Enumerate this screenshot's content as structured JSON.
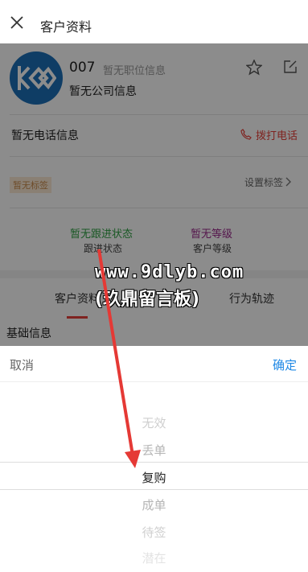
{
  "header": {
    "title": "客户资料"
  },
  "profile": {
    "name": "007",
    "job": "暂无职位信息",
    "company": "暂无公司信息",
    "phone": "暂无电话信息",
    "call_label": "拨打电话",
    "tag": "暂无标签",
    "set_tags": "设置标签",
    "follow_status": "暂无跟进状态",
    "follow_label": "跟进状态",
    "level_status": "暂无等级",
    "level_label": "客户等级"
  },
  "tabs": [
    "客户资料",
    "行为轨迹"
  ],
  "section_title": "基础信息",
  "watermark": {
    "line1": "www.9dlyb.com",
    "line2": "(玖鼎留言板)"
  },
  "picker": {
    "cancel": "取消",
    "confirm": "确定",
    "options": [
      "无效",
      "丢单",
      "复购",
      "成单",
      "待签",
      "潜在"
    ],
    "selected": "复购"
  },
  "colors": {
    "call": "#e8413b",
    "confirm": "#1e88e5",
    "follow": "#2ea043",
    "level": "#9b2a8c",
    "arrow": "#e53935"
  }
}
